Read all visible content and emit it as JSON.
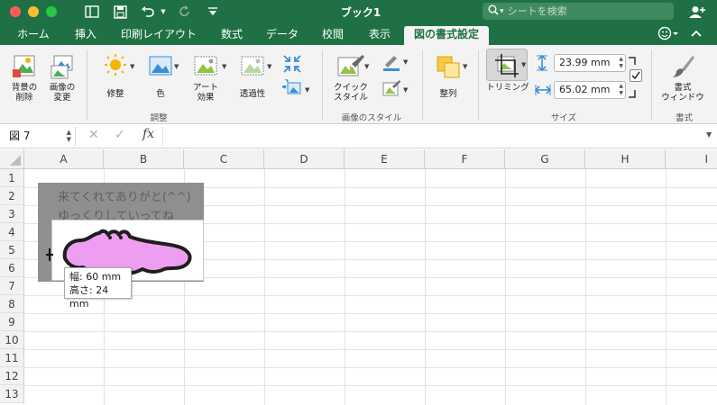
{
  "window": {
    "title": "ブック1"
  },
  "search": {
    "placeholder": "シートを検索"
  },
  "tabs": [
    "ホーム",
    "挿入",
    "印刷レイアウト",
    "数式",
    "データ",
    "校閲",
    "表示",
    "図の書式設定"
  ],
  "ribbon": {
    "adjust": {
      "remove_bg": "背景の\n削除",
      "change_pic": "画像の\n変更",
      "corrections": "修整",
      "color": "色",
      "artistic": "アート\n効果",
      "transparency": "透過性",
      "group_label": "調整"
    },
    "styles": {
      "quick_styles": "クイック\nスタイル",
      "group_label": "画像のスタイル"
    },
    "arrange": {
      "label": "整列"
    },
    "size": {
      "crop": "トリミング",
      "height": "23.99 mm",
      "width": "65.02 mm",
      "group_label": "サイズ"
    },
    "format_pane": {
      "label": "書式\nウィンドウ",
      "group_label": "書式"
    }
  },
  "formula_bar": {
    "name_box": "図 7",
    "fx": "fx"
  },
  "grid": {
    "columns": [
      "A",
      "B",
      "C",
      "D",
      "E",
      "F",
      "G",
      "H",
      "I"
    ],
    "rows": [
      "1",
      "2",
      "3",
      "4",
      "5",
      "6",
      "7",
      "8",
      "9",
      "10",
      "11",
      "12",
      "13"
    ]
  },
  "cells": {
    "line1": "来てくれてありがと(^^)",
    "line2": "ゆっくりしていってね"
  },
  "tooltip": {
    "width": "幅:  60 mm",
    "height": "高さ:  24 mm"
  },
  "colors": {
    "accent": "#1f7145",
    "drawing_fill": "#ee9ef0",
    "drawing_outline": "#1e1e1e"
  }
}
